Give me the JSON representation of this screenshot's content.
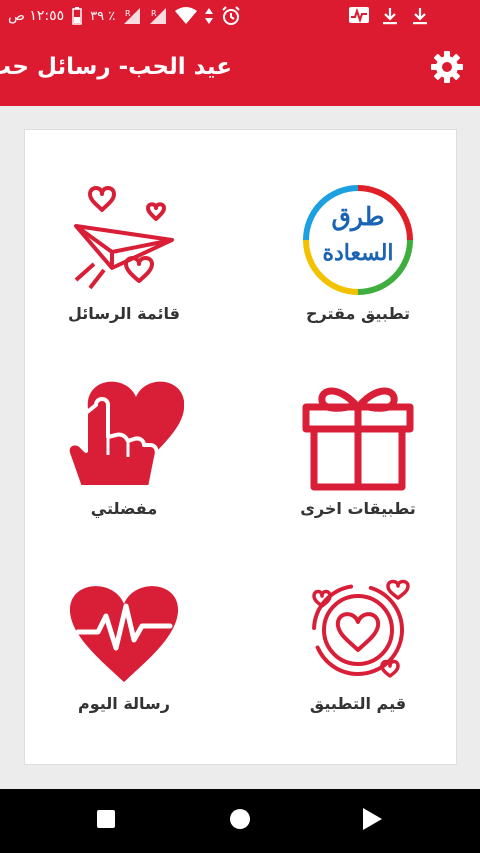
{
  "status_bar": {
    "time": "١٢:٥٥ ص",
    "battery": "٣٩ ٪"
  },
  "toolbar": {
    "title": "عيد الحب- رسائل حب",
    "settings_icon": "gear-icon"
  },
  "menu": [
    {
      "id": "suggested-app",
      "label": "تطبيق مقترح",
      "logo_text_line1": "طرق",
      "logo_text_line2": "السعادة",
      "icon": "turuq-alsaada-logo"
    },
    {
      "id": "messages-list",
      "label": "قائمة الرسائل",
      "icon": "paper-plane-hearts-icon"
    },
    {
      "id": "other-apps",
      "label": "تطبيقات اخرى",
      "icon": "gift-box-icon"
    },
    {
      "id": "favorites",
      "label": "مفضلتي",
      "icon": "heart-finger-icon"
    },
    {
      "id": "rate-app",
      "label": "قيم التطبيق",
      "icon": "heart-circle-icon"
    },
    {
      "id": "todays-message",
      "label": "رسالة اليوم",
      "icon": "heartbeat-icon"
    }
  ],
  "colors": {
    "primary": "#dc1a30",
    "icon_red": "#d91f37",
    "logo_blue": "#1b64b5"
  }
}
